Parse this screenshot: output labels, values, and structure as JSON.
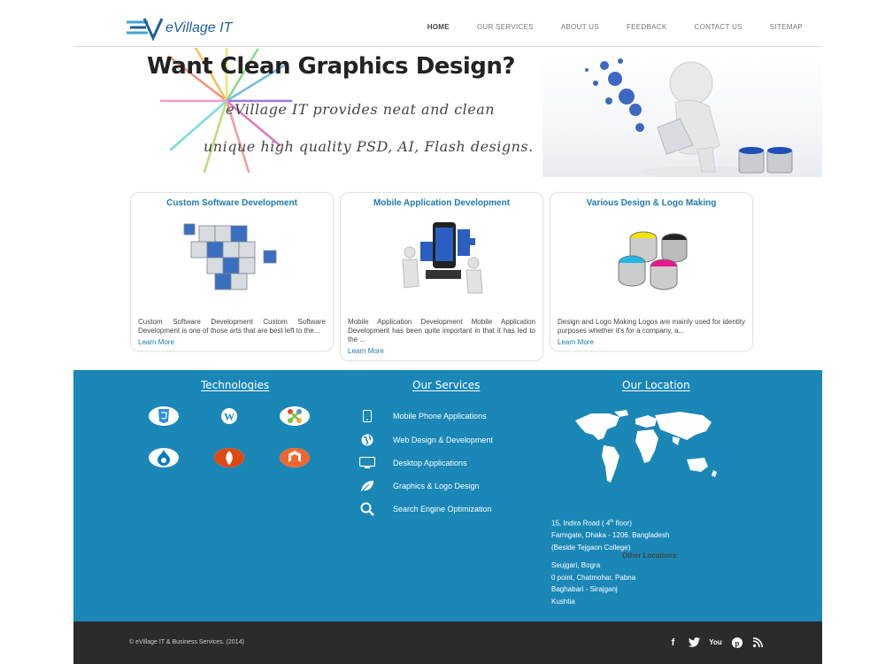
{
  "header": {
    "logo_text": "eVillage IT",
    "nav": [
      "HOME",
      "OUR SERVICES",
      "ABOUT US",
      "FEEDBACK",
      "CONTACT US",
      "SITEMAP"
    ]
  },
  "banner": {
    "title": "Want Clean Graphics Design?",
    "line1": "eVillage IT provides neat and clean",
    "line2": "unique high quality PSD, AI, Flash designs."
  },
  "cards": [
    {
      "title": "Custom Software Development",
      "text": "Custom Software Development Custom Software Development is one of those arts that are best left to the...",
      "more": "Learn More",
      "icon": "cubes-icon"
    },
    {
      "title": "Mobile Application Development",
      "text": "Mobile Application Development Mobile Application Development has been quite important in that it has led to the ...",
      "more": "Learn More",
      "icon": "puzzle-phone-icon"
    },
    {
      "title": "Various Design & Logo Making",
      "text": "Design and Logo Making Logos are mainly used for identity purposes whether it's for a company, a...",
      "more": "Learn More",
      "icon": "paint-buckets-icon"
    }
  ],
  "technologies": {
    "title": "Technologies",
    "items": [
      "html5-icon",
      "wordpress-icon",
      "joomla-icon",
      "drupal-icon",
      "codeigniter-icon",
      "magento-icon"
    ]
  },
  "services": {
    "title": "Our Services",
    "items": [
      {
        "label": "Mobile Phone Applications",
        "icon": "mobile-icon"
      },
      {
        "label": "Web Design & Development",
        "icon": "globe-icon"
      },
      {
        "label": "Desktop Applications",
        "icon": "monitor-icon"
      },
      {
        "label": "Graphics & Logo Design",
        "icon": "leaf-icon"
      },
      {
        "label": "Search Engine Optimization",
        "icon": "search-icon"
      }
    ]
  },
  "location": {
    "title": "Our Location",
    "addr_line1_pre": "15, Indira Road ( 4",
    "addr_line1_sup": "th",
    "addr_line1_post": " floor)",
    "addr_line2": "Farmgate, Dhaka - 1206. Bangladesh",
    "addr_line3": "(Beside Tejgaon College)",
    "other_title": "Other Locations:",
    "others": [
      "Seujgari, Bogra",
      "0 point, Chatmohar, Pabna",
      "Baghabari - Sirajganj",
      "Kushtia"
    ]
  },
  "footer": {
    "copyright": "© eVillage IT & Business Services. (2014)",
    "social": [
      {
        "name": "facebook-icon",
        "glyph": "f"
      },
      {
        "name": "twitter-icon",
        "glyph": "t"
      },
      {
        "name": "youtube-icon",
        "glyph": "You"
      },
      {
        "name": "pinterest-icon",
        "glyph": "p"
      },
      {
        "name": "rss-icon",
        "glyph": "⦿"
      }
    ]
  },
  "colors": {
    "accent": "#1f7aad",
    "panel": "#1a87b7",
    "footer": "#2b2b2b"
  }
}
